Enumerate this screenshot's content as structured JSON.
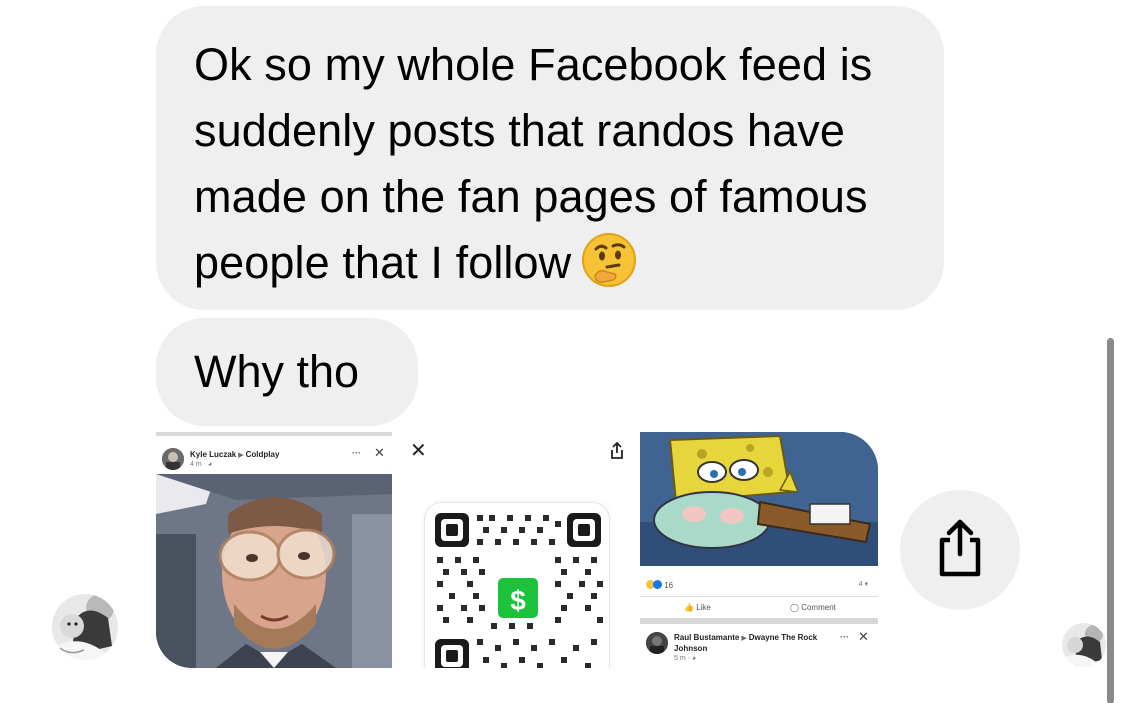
{
  "messages": [
    {
      "id": "msg-1",
      "text": "Ok so my whole Facebook feed is suddenly posts that randos have made on the fan pages of famous people that I follow",
      "emoji": "thinking-face"
    },
    {
      "id": "msg-2",
      "text": "Why tho"
    }
  ],
  "attachments": {
    "post1": {
      "author": "Kyle Luczak",
      "page": "Coldplay",
      "time": "4 m · ",
      "more_icon": "ellipsis-icon",
      "close_icon": "close-icon"
    },
    "qr": {
      "close_label": "✕",
      "badge_label": "$",
      "share_icon": "share-icon"
    },
    "post2": {
      "reaction_count": "16",
      "reaction_right": "4",
      "like_label": "Like",
      "comment_label": "Comment",
      "author": "Raul Bustamante",
      "page_line1": "Dwayne The Rock",
      "page_line2": "Johnson",
      "time": "5 m · "
    }
  },
  "share_button": {
    "icon": "share-icon"
  },
  "colors": {
    "bubble": "#efefef",
    "cash_green": "#1cc23b",
    "fb_blue": "#1877f2"
  }
}
